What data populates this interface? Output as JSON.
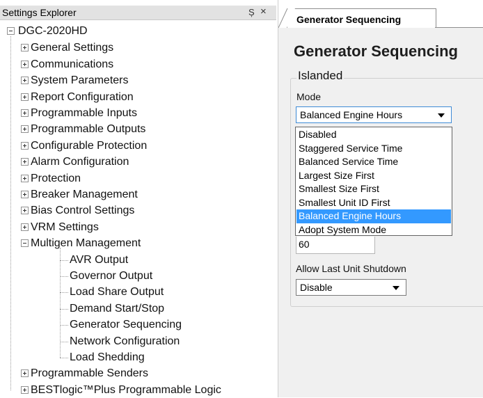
{
  "explorer": {
    "title": "Settings Explorer",
    "pin_glyph": "Ș",
    "close_glyph": "×",
    "root": "DGC-2020HD",
    "items": [
      {
        "label": "General Settings"
      },
      {
        "label": "Communications"
      },
      {
        "label": "System Parameters"
      },
      {
        "label": "Report Configuration"
      },
      {
        "label": "Programmable Inputs"
      },
      {
        "label": "Programmable Outputs"
      },
      {
        "label": "Configurable Protection"
      },
      {
        "label": "Alarm Configuration"
      },
      {
        "label": "Protection"
      },
      {
        "label": "Breaker Management"
      },
      {
        "label": "Bias Control Settings"
      },
      {
        "label": "VRM Settings"
      },
      {
        "label": "Multigen Management"
      },
      {
        "label": "Programmable Senders"
      },
      {
        "label": "BESTlogic™Plus Programmable Logic"
      }
    ],
    "multigen_children": [
      {
        "label": "AVR Output"
      },
      {
        "label": "Governor Output"
      },
      {
        "label": "Load Share Output"
      },
      {
        "label": "Demand Start/Stop"
      },
      {
        "label": "Generator Sequencing"
      },
      {
        "label": "Network Configuration"
      },
      {
        "label": "Load Shedding"
      }
    ]
  },
  "tab": {
    "label": "Generator Sequencing"
  },
  "page": {
    "heading": "Generator Sequencing",
    "group_title": "Islanded",
    "mode_label": "Mode",
    "mode_value": "Balanced Engine Hours",
    "mode_options": [
      "Disabled",
      "Staggered Service Time",
      "Balanced Service Time",
      "Largest Size First",
      "Smallest Size First",
      "Smallest Unit ID First",
      "Balanced Engine Hours",
      "Adopt System Mode"
    ],
    "selected_option": "Balanced Engine Hours",
    "numeric_value": "60",
    "shutdown_label": "Allow Last Unit Shutdown",
    "shutdown_value": "Disable"
  },
  "colors": {
    "selection": "#3399ff",
    "focus_border": "#3d8ad6"
  }
}
